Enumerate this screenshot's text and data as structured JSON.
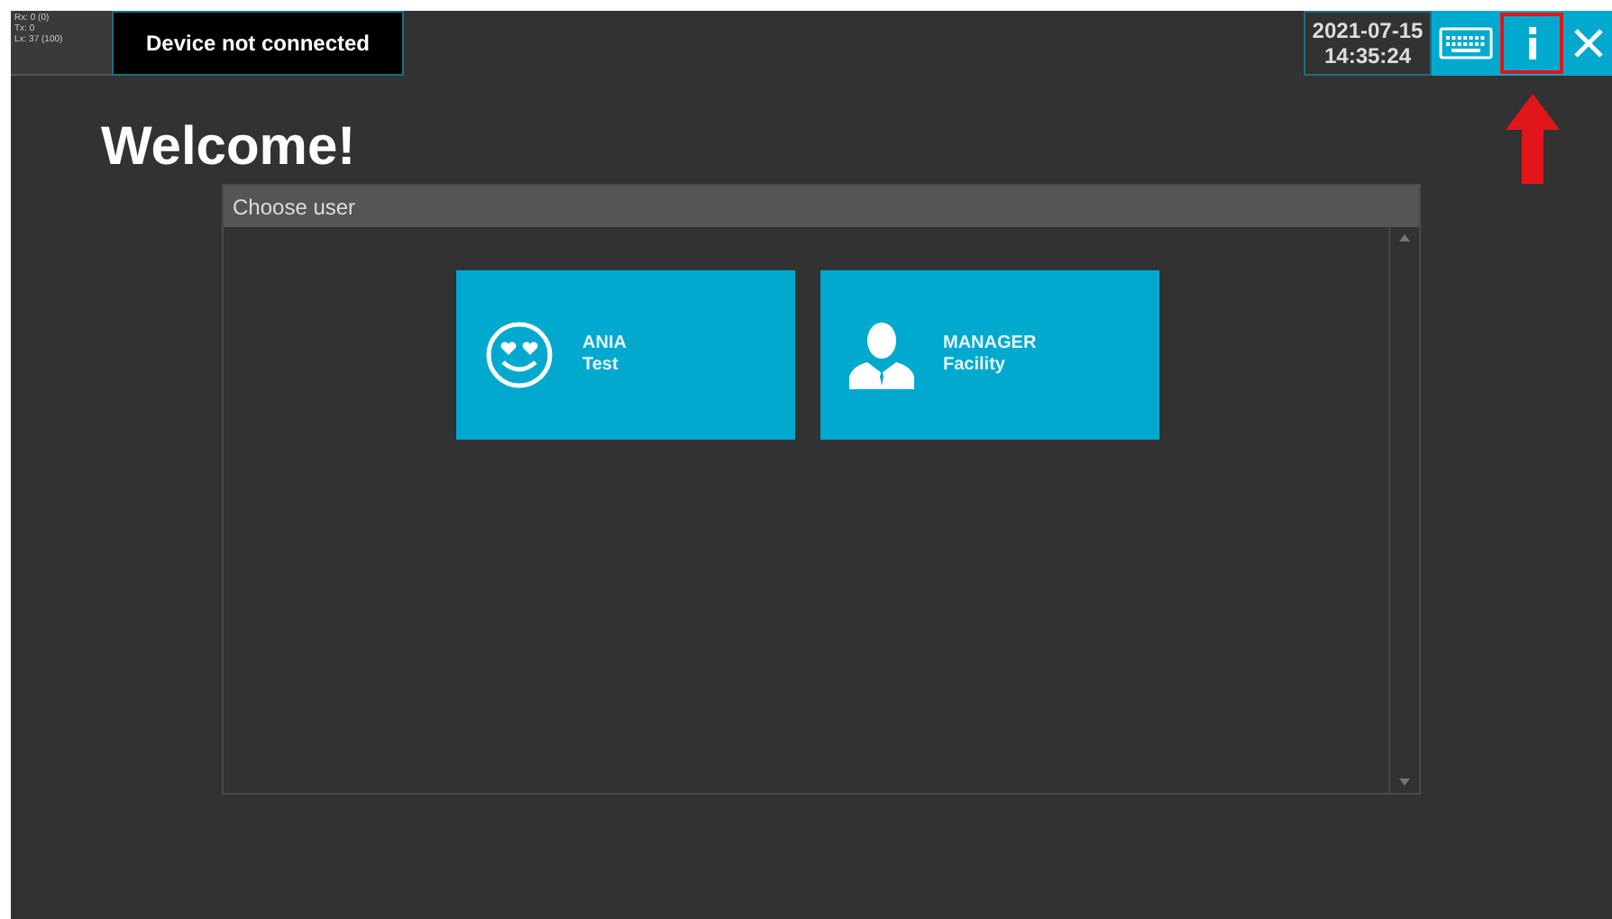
{
  "status": {
    "lines": [
      "Rx: 0 (0)",
      "Tx: 0",
      "Lx: 37 (100)"
    ],
    "device": "Device not connected"
  },
  "clock": {
    "date": "2021-07-15",
    "time": "14:35:24"
  },
  "toolbar": [
    {
      "kind": "keyboard",
      "highlighted": false
    },
    {
      "kind": "info",
      "highlighted": true
    },
    {
      "kind": "close",
      "highlighted": false
    }
  ],
  "title": "Welcome!",
  "panel": {
    "title": "Choose user",
    "users": [
      {
        "kind": "smiley",
        "name": "ANIA",
        "role": "Test"
      },
      {
        "kind": "person",
        "name": "MANAGER",
        "role": "Facility"
      }
    ]
  }
}
